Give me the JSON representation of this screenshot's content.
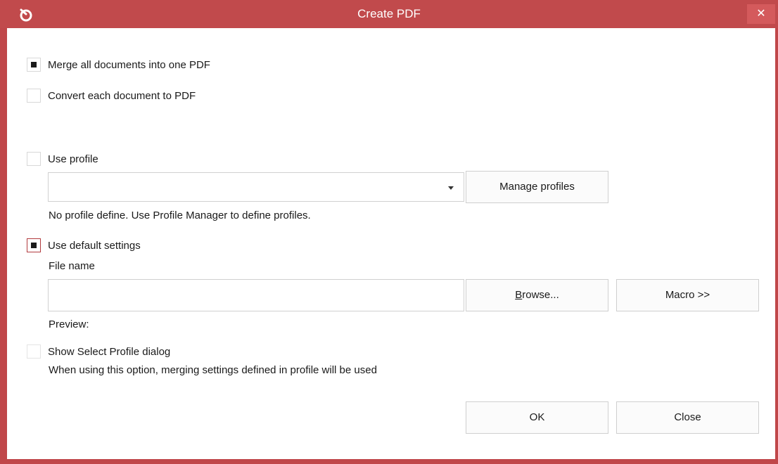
{
  "window": {
    "title": "Create PDF",
    "close_glyph": "✕",
    "accent_color": "#c14a4c"
  },
  "options": {
    "merge_label": "Merge all documents into one PDF",
    "merge_checked": true,
    "convert_label": "Convert each document to PDF",
    "convert_checked": false,
    "use_profile_label": "Use profile",
    "use_profile_checked": false,
    "profile_select_value": "",
    "manage_profiles_label": "Manage profiles",
    "no_profile_text": "No profile define. Use Profile Manager to define profiles.",
    "use_default_label": "Use default settings",
    "use_default_checked": true,
    "file_name_label": "File name",
    "file_name_value": "",
    "browse_prefix": "B",
    "browse_rest": "rowse...",
    "macro_label": "Macro >>",
    "preview_label": "Preview:",
    "show_select_label": "Show Select Profile dialog",
    "show_select_checked": false,
    "show_select_note": "When using this option, merging settings defined in profile will be used"
  },
  "footer": {
    "ok_label": "OK",
    "close_label": "Close"
  },
  "icons": {
    "app": "app-logo-icon",
    "close": "close-icon",
    "dropdown": "chevron-down-icon"
  }
}
